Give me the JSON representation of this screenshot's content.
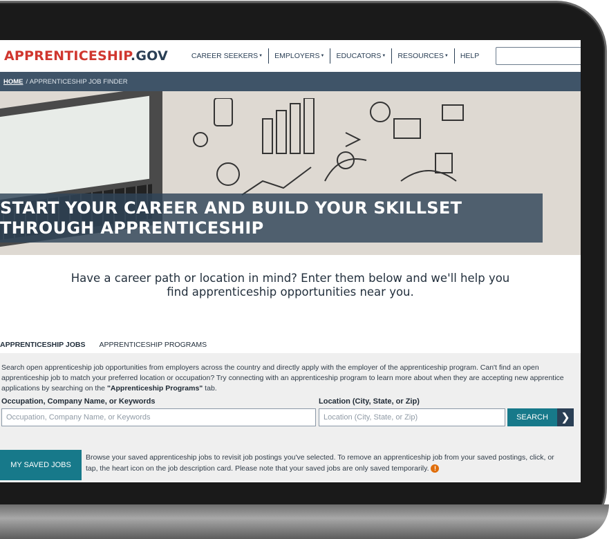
{
  "header": {
    "logo_main": "APPRENTICESHIP",
    "logo_suffix": ".GOV",
    "nav": [
      {
        "label": "CAREER SEEKERS",
        "caret": "▼"
      },
      {
        "label": "EMPLOYERS",
        "caret": "▼"
      },
      {
        "label": "EDUCATORS",
        "caret": "▼"
      },
      {
        "label": "RESOURCES",
        "caret": "▼"
      },
      {
        "label": "HELP",
        "caret": ""
      }
    ],
    "search_icon": "search-icon"
  },
  "breadcrumb": {
    "home": "HOME",
    "separator": "/",
    "current": "APPRENTICESHIP JOB FINDER"
  },
  "hero": {
    "line1": "START YOUR CAREER AND BUILD YOUR SKILLSET",
    "line2": "THROUGH APPRENTICESHIP"
  },
  "intro": {
    "line1": "Have a career path or location in mind? Enter them below and we'll help you",
    "line2": "find apprenticeship opportunities near you."
  },
  "tabs": [
    {
      "label": "APPRENTICESHIP JOBS",
      "active": true
    },
    {
      "label": "APPRENTICESHIP PROGRAMS",
      "active": false
    }
  ],
  "panel": {
    "desc_before": "Search open apprenticeship job opportunities from employers across the country and directly apply with the employer of the apprenticeship program. Can't find an open apprenticeship job to match your preferred location or occupation? Try connecting with an apprenticeship program to learn more about when they are accepting new apprentice applications by searching on the ",
    "desc_bold": "\"Apprenticeship Programs\"",
    "desc_after": " tab.",
    "occupation_label": "Occupation, Company Name, or Keywords",
    "occupation_placeholder": "Occupation, Company Name, or Keywords",
    "location_label": "Location (City, State, or Zip)",
    "location_placeholder": "Location (City, State, or Zip)",
    "search_label": "SEARCH",
    "search_arrow": "❯"
  },
  "saved": {
    "button_label": "MY SAVED JOBS",
    "text": "Browse your saved apprenticeship jobs to revisit job postings you've selected. To remove an apprenticeship job from your saved postings, click, or tap, the heart icon on the job description card. Please note that your saved jobs are only saved temporarily.",
    "info_glyph": "!"
  },
  "colors": {
    "brand_red": "#d0372f",
    "navy": "#2a3f55",
    "teal": "#17798a",
    "breadcrumb_bg": "#3f5468"
  }
}
